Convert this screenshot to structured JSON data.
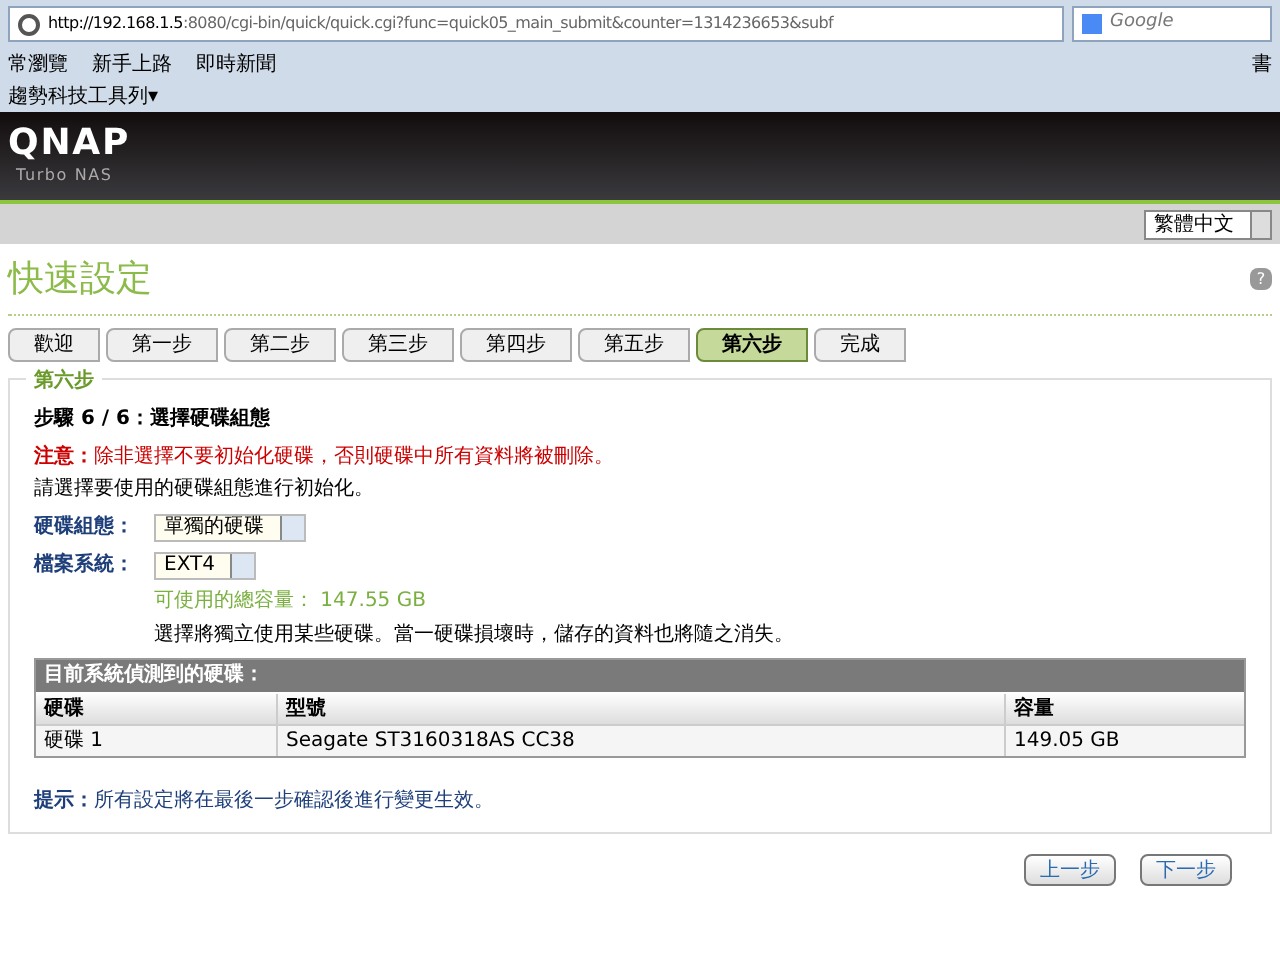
{
  "browser": {
    "url_host": "http://192.168.1.5",
    "url_rest": ":8080/cgi-bin/quick/quick.cgi?func=quick05_main_submit&counter=1314236653&subf",
    "search_placeholder": "Google",
    "bookmarks": [
      "常瀏覽",
      "新手上路",
      "即時新聞"
    ],
    "bookmarks_right": "書",
    "toolbar": "趨勢科技工具列▾"
  },
  "header": {
    "logo": "QNAP",
    "subtitle": "Turbo NAS",
    "language": "繁體中文"
  },
  "page": {
    "title": "快速設定",
    "help": "?"
  },
  "steps": [
    {
      "label": "歡迎",
      "selected": false
    },
    {
      "label": "第一步",
      "selected": false
    },
    {
      "label": "第二步",
      "selected": false
    },
    {
      "label": "第三步",
      "selected": false
    },
    {
      "label": "第四步",
      "selected": false
    },
    {
      "label": "第五步",
      "selected": false
    },
    {
      "label": "第六步",
      "selected": true
    },
    {
      "label": "完成",
      "selected": false
    }
  ],
  "panel": {
    "legend": "第六步",
    "heading": "步驟 6 / 6：選擇硬碟組態",
    "warning_label": "注意：",
    "warning": "除非選擇不要初始化硬碟，否則硬碟中所有資料將被刪除。",
    "instruction": "請選擇要使用的硬碟組態進行初始化。",
    "fields": [
      {
        "label": "硬碟組態：",
        "value": "單獨的硬碟"
      },
      {
        "label": "檔案系統：",
        "value": "EXT4"
      }
    ],
    "capacity": "可使用的總容量： 147.55 GB",
    "note": "選擇將獨立使用某些硬碟。當一硬碟損壞時，儲存的資料也將隨之消失。",
    "table": {
      "caption": "目前系統偵測到的硬碟：",
      "columns": [
        "硬碟",
        "型號",
        "容量"
      ],
      "rows": [
        [
          "硬碟 1",
          "Seagate ST3160318AS CC38",
          "149.05 GB"
        ]
      ]
    },
    "tip_label": "提示：",
    "tip": "所有設定將在最後一步確認後進行變更生效。"
  },
  "buttons": [
    "上一步",
    "下一步"
  ]
}
